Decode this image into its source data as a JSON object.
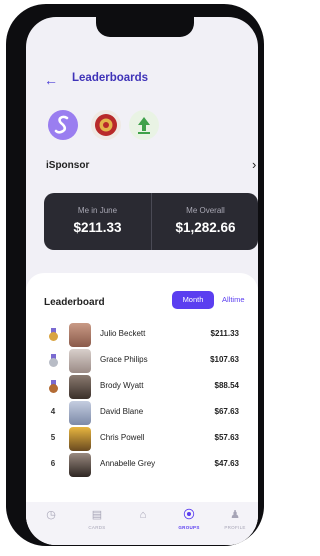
{
  "header": {
    "back_icon": "arrow-left-icon",
    "title": "Leaderboards"
  },
  "sponsors": {
    "name": "iSponsor",
    "logos": [
      "purple-s-logo",
      "red-gold-crest-logo",
      "green-tree-logo"
    ]
  },
  "stats": {
    "left_label": "Me in June",
    "left_value": "$211.33",
    "right_label": "Me Overall",
    "right_value": "$1,282.66"
  },
  "leaderboard": {
    "title": "Leaderboard",
    "tab_month": "Month",
    "tab_alltime": "Alltime",
    "rows": [
      {
        "rank": "",
        "medal": "gold",
        "name": "Julio Beckett",
        "amount": "$211.33"
      },
      {
        "rank": "",
        "medal": "silver",
        "name": "Grace Philips",
        "amount": "$107.63"
      },
      {
        "rank": "",
        "medal": "bronze",
        "name": "Brody Wyatt",
        "amount": "$88.54"
      },
      {
        "rank": "4",
        "medal": "",
        "name": "David Blane",
        "amount": "$67.63"
      },
      {
        "rank": "5",
        "medal": "",
        "name": "Chris Powell",
        "amount": "$57.63"
      },
      {
        "rank": "6",
        "medal": "",
        "name": "Annabelle Grey",
        "amount": "$47.63"
      }
    ]
  },
  "nav": {
    "items": [
      {
        "label": "",
        "icon": "clock-icon"
      },
      {
        "label": "CARDS",
        "icon": "cards-icon"
      },
      {
        "label": "",
        "icon": "home-icon"
      },
      {
        "label": "GROUPS",
        "icon": "groups-icon",
        "active": true
      },
      {
        "label": "PROFILE",
        "icon": "profile-icon"
      }
    ]
  },
  "colors": {
    "accent": "#5b3ef0",
    "dark_card": "#2a2a32",
    "gold": "#d9a441",
    "silver": "#b8bcc6",
    "bronze": "#b36b34"
  }
}
